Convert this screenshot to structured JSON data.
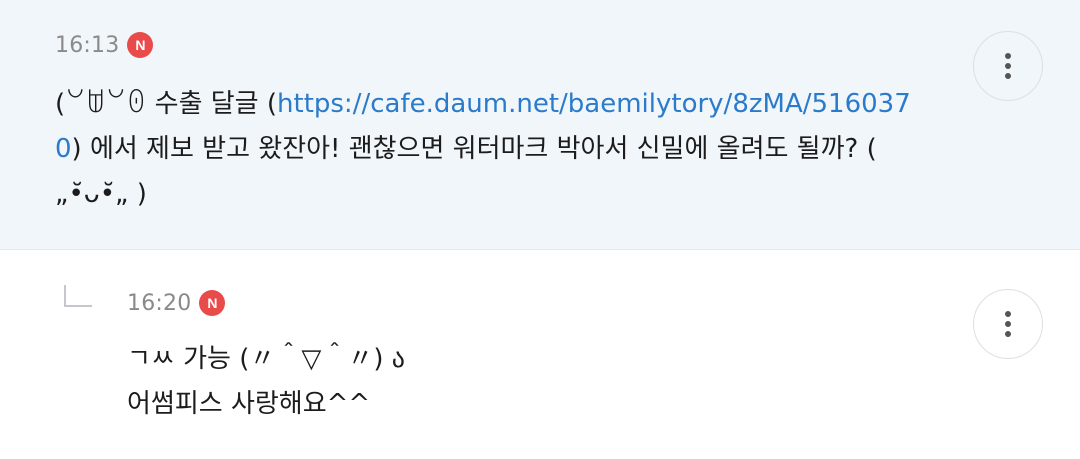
{
  "comment": {
    "time": "16:13",
    "badge": "N",
    "text_before": "(꒡ꌂ꒡ꏿ 수출 달글 (",
    "link": "https://cafe.daum.net/baemilytory/8zMA/5160370",
    "text_after": ") 에서 제보 받고 왔잔아! 괜찮으면 워터마크 박아서 신밀에 올려도 될까? ( „•̆ᴗ•̆„ )"
  },
  "reply": {
    "time": "16:20",
    "badge": "N",
    "line1": "ㄱㅆ 가능 (〃＾▽＾〃) ა",
    "line2": "어썸피스 사랑해요^^"
  },
  "icons": {
    "more": "more-vertical-icon",
    "reply_arrow": "reply-arrow-icon"
  },
  "colors": {
    "link": "#2a7bc9",
    "badge": "#e94a4a",
    "top_background": "#f1f6fb"
  }
}
